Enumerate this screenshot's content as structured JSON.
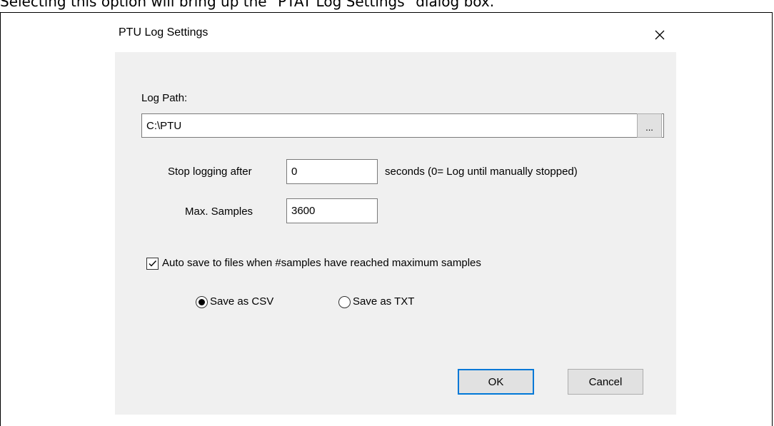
{
  "caption": "Selecting this option will bring up the \"PTAT Log Settings\" dialog box.",
  "dialog": {
    "title": "PTU Log Settings",
    "log_path_label": "Log Path:",
    "log_path_value": "C:\\PTU",
    "browse_label": "...",
    "stop_logging_label": "Stop logging after",
    "stop_logging_value": "0",
    "seconds_hint": "seconds (0= Log until manually stopped)",
    "max_samples_label": "Max. Samples",
    "max_samples_value": "3600",
    "auto_save_label": "Auto save to files when #samples have reached maximum samples",
    "auto_save_checked": true,
    "save_csv_label": "Save as CSV",
    "save_txt_label": "Save as TXT",
    "selected_format": "csv",
    "ok_label": "OK",
    "cancel_label": "Cancel"
  },
  "icons": {
    "close": "close-icon",
    "check": "checkmark-icon"
  },
  "colors": {
    "dialog_bg": "#f0f0f0",
    "default_button_border": "#0078d7"
  }
}
